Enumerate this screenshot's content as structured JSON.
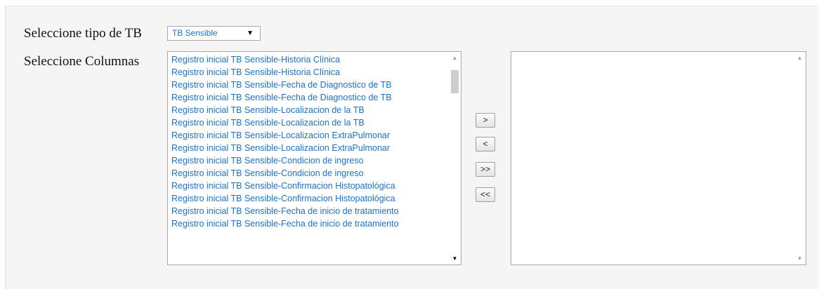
{
  "form": {
    "tipo_label": "Seleccione tipo de TB",
    "tipo_selected": "TB Sensible",
    "columnas_label": "Seleccione Columnas"
  },
  "available_columns": [
    "Registro inicial TB Sensible-Historia Clínica",
    "Registro inicial TB Sensible-Historia Clínica",
    "Registro inicial TB Sensible-Fecha de Diagnostico de TB",
    "Registro inicial TB Sensible-Fecha de Diagnostico de TB",
    "Registro inicial TB Sensible-Localizacion de la TB",
    "Registro inicial TB Sensible-Localizacion de la TB",
    "Registro inicial TB Sensible-Localizacion ExtraPulmonar",
    "Registro inicial TB Sensible-Localizacion ExtraPulmonar",
    "Registro inicial TB Sensible-Condicion de ingreso",
    "Registro inicial TB Sensible-Condicion de ingreso",
    "Registro inicial TB Sensible-Confirmacion Histopatológica",
    "Registro inicial TB Sensible-Confirmacion Histopatológica",
    "Registro inicial TB Sensible-Fecha de inicio de tratamiento",
    "Registro inicial TB Sensible-Fecha de inicio de tratamiento"
  ],
  "selected_columns": [],
  "buttons": {
    "add": ">",
    "remove": "<",
    "add_all": ">>",
    "remove_all": "<<"
  },
  "colors": {
    "option_text": "#1a73c9",
    "panel_bg": "#f5f5f5"
  }
}
